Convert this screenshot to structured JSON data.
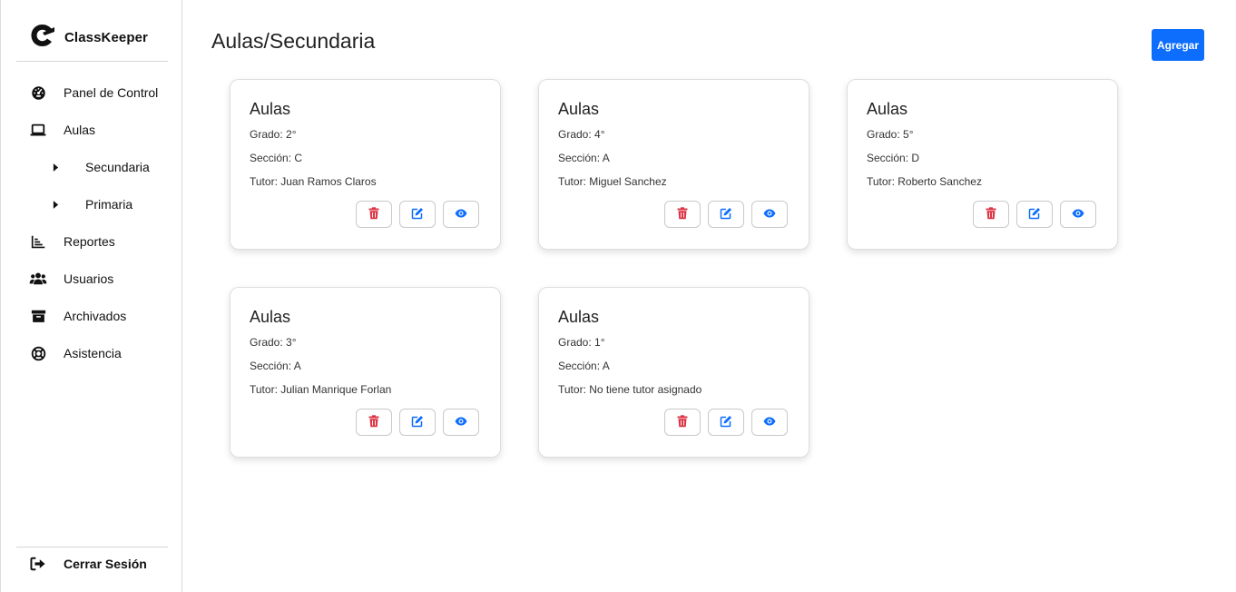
{
  "app": {
    "name": "ClassKeeper"
  },
  "sidebar": {
    "items": [
      {
        "label": "Panel de Control",
        "icon": "dashboard-gauge-icon"
      },
      {
        "label": "Aulas",
        "icon": "laptop-icon"
      },
      {
        "label": "Reportes",
        "icon": "bar-chart-icon"
      },
      {
        "label": "Usuarios",
        "icon": "users-icon"
      },
      {
        "label": "Archivados",
        "icon": "archive-box-icon"
      },
      {
        "label": "Asistencia",
        "icon": "lifebuoy-icon"
      }
    ],
    "subitems": [
      {
        "label": "Secundaria",
        "icon": "caret-right-icon"
      },
      {
        "label": "Primaria",
        "icon": "caret-right-icon"
      }
    ],
    "logout": {
      "label": "Cerrar Sesión",
      "icon": "sign-out-icon"
    }
  },
  "header": {
    "title": "Aulas/Secundaria",
    "add_label": "Agregar"
  },
  "cards": [
    {
      "title": "Aulas",
      "grado": "Grado: 2°",
      "seccion": "Sección: C",
      "tutor": "Tutor: Juan Ramos Claros"
    },
    {
      "title": "Aulas",
      "grado": "Grado: 4°",
      "seccion": "Sección: A",
      "tutor": "Tutor: Miguel Sanchez"
    },
    {
      "title": "Aulas",
      "grado": "Grado: 5°",
      "seccion": "Sección: D",
      "tutor": "Tutor: Roberto Sanchez"
    },
    {
      "title": "Aulas",
      "grado": "Grado: 3°",
      "seccion": "Sección: A",
      "tutor": "Tutor: Julian Manrique Forlan"
    },
    {
      "title": "Aulas",
      "grado": "Grado: 1°",
      "seccion": "Sección: A",
      "tutor": "Tutor: No tiene tutor asignado"
    }
  ],
  "colors": {
    "primary": "#0d6efd",
    "delete": "#dc3545",
    "edit": "#0d6efd",
    "view": "#0d6efd"
  },
  "card_action_icons": [
    "trash-icon",
    "edit-icon",
    "eye-icon"
  ]
}
